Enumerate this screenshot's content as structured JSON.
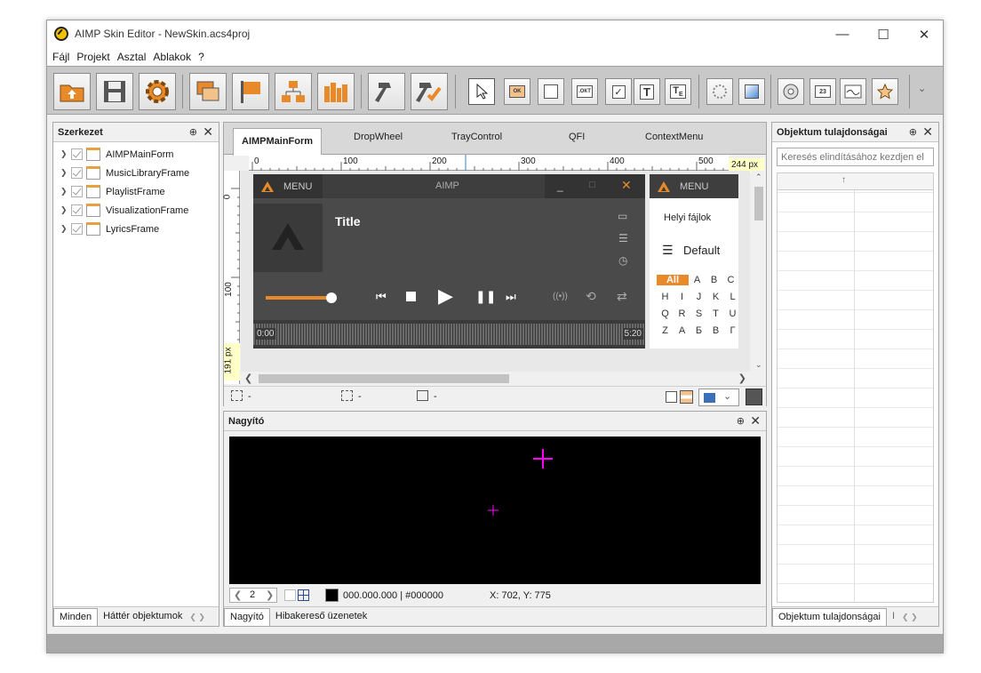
{
  "window": {
    "title": "AIMP Skin Editor - NewSkin.acs4proj"
  },
  "menu": [
    "Fájl",
    "Projekt",
    "Asztal",
    "Ablakok",
    "?"
  ],
  "structure_panel": {
    "title": "Szerkezet",
    "items": [
      "AIMPMainForm",
      "MusicLibraryFrame",
      "PlaylistFrame",
      "VisualizationFrame",
      "LyricsFrame"
    ],
    "tabs": [
      "Minden",
      "Háttér objektumok"
    ]
  },
  "designer": {
    "tabs": [
      "AIMPMainForm",
      "DropWheel",
      "TrayControl",
      "QFI",
      "ContextMenu"
    ],
    "ruler_h": [
      "0",
      "100",
      "200",
      "300",
      "400",
      "500"
    ],
    "ruler_v": [
      "0",
      "100"
    ],
    "width_px": "244 px",
    "height_px": "191 px",
    "player": {
      "menu": "MENU",
      "brand": "AIMP",
      "track_title": "Title",
      "time_start": "0:00",
      "time_end": "5:20",
      "volume": 0.92
    },
    "playlist": {
      "menu": "MENU",
      "tab": "Helyi fájlok",
      "name": "Default",
      "letters": [
        [
          "All",
          "A",
          "B",
          "C"
        ],
        [
          "H",
          "I",
          "J",
          "K",
          "L"
        ],
        [
          "Q",
          "R",
          "S",
          "T",
          "U"
        ],
        [
          "Z",
          "А",
          "Б",
          "В",
          "Г"
        ]
      ]
    },
    "status": [
      "-",
      "-",
      "-"
    ]
  },
  "magnifier": {
    "title": "Nagyító",
    "zoom": "2",
    "color_value": "000.000.000 | #000000",
    "coords": "X: 702, Y: 775",
    "tabs": [
      "Nagyító",
      "Hibakereső üzenetek"
    ]
  },
  "properties": {
    "title": "Objektum tulajdonságai",
    "search_placeholder": "Keresés elindításához kezdjen el",
    "tabs": [
      "Objektum tulajdonságai",
      "I"
    ]
  },
  "colors": {
    "accent": "#e8892a",
    "magenta": "#ff00ff"
  }
}
